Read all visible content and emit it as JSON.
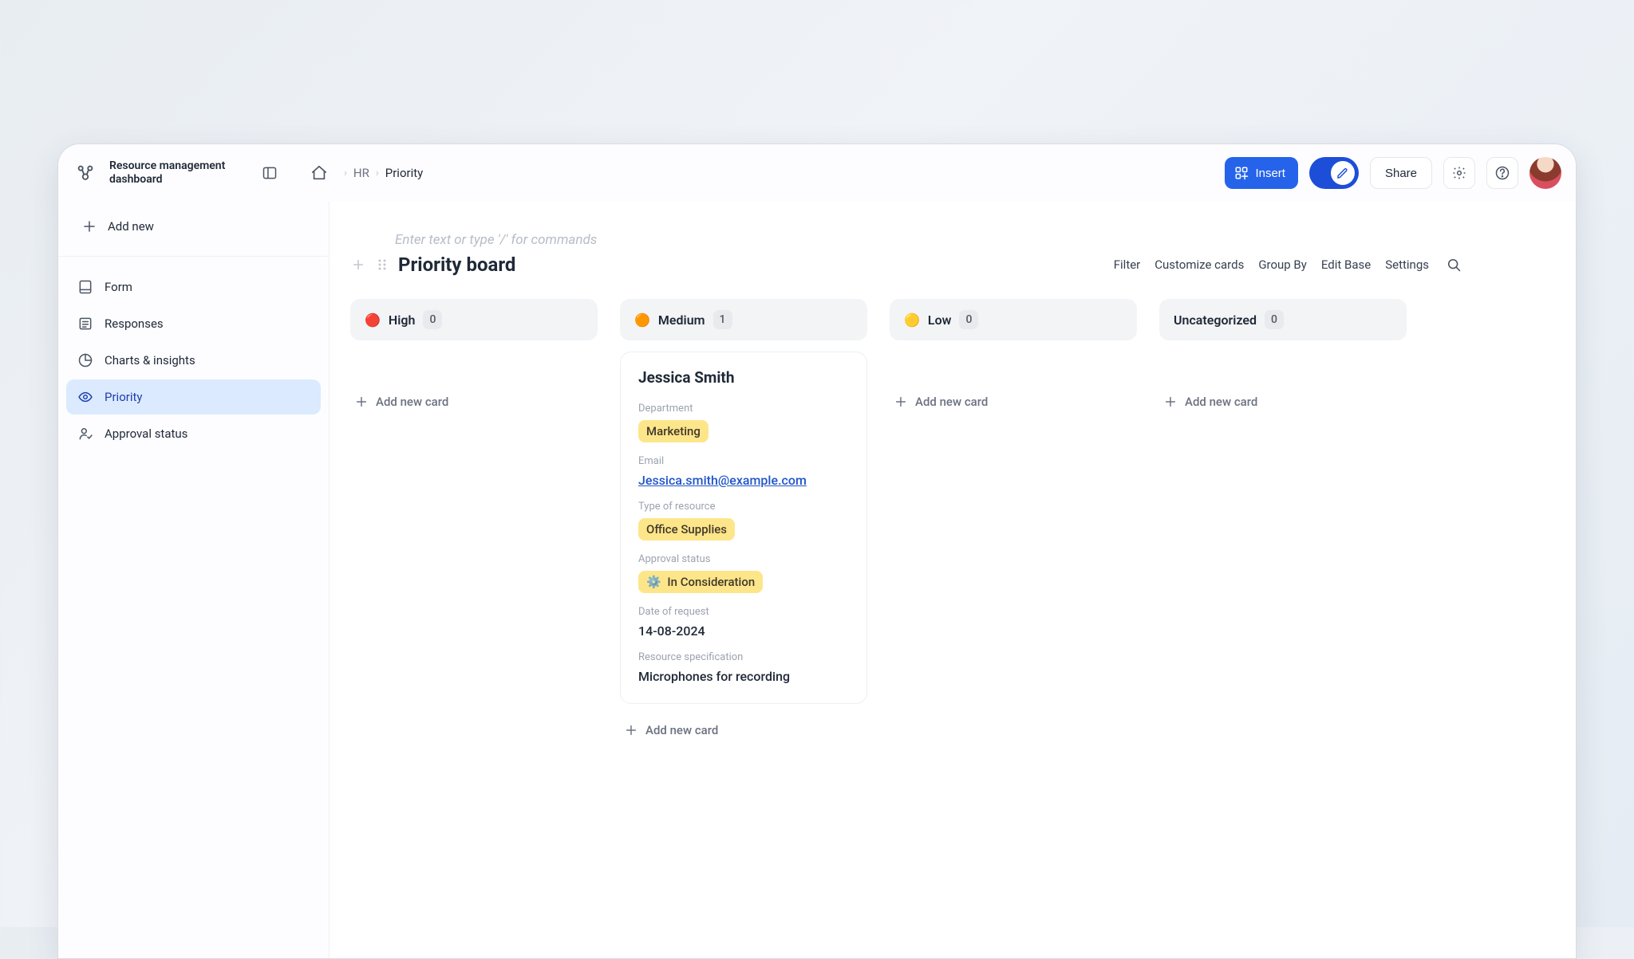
{
  "workspace_title": "Resource management dashboard",
  "breadcrumbs": {
    "section": "HR",
    "page": "Priority"
  },
  "topbar": {
    "insert_label": "Insert",
    "share_label": "Share"
  },
  "sidebar": {
    "add_new_label": "Add new",
    "items": [
      {
        "label": "Form"
      },
      {
        "label": "Responses"
      },
      {
        "label": "Charts & insights"
      },
      {
        "label": "Priority"
      },
      {
        "label": "Approval status"
      }
    ],
    "active_index": 3
  },
  "doc_placeholder": "Enter text or type '/' for commands",
  "board_title": "Priority board",
  "board_actions": {
    "filter": "Filter",
    "customize": "Customize cards",
    "group_by": "Group By",
    "edit_base": "Edit Base",
    "settings": "Settings"
  },
  "columns": [
    {
      "emoji": "🔴",
      "name": "High",
      "count": "0",
      "add_label": "Add new card"
    },
    {
      "emoji": "🟠",
      "name": "Medium",
      "count": "1",
      "add_label": "Add new card"
    },
    {
      "emoji": "🟡",
      "name": "Low",
      "count": "0",
      "add_label": "Add new card"
    },
    {
      "emoji": "",
      "name": "Uncategorized",
      "count": "0",
      "add_label": "Add new card"
    }
  ],
  "card": {
    "title": "Jessica Smith",
    "department_label": "Department",
    "department": "Marketing",
    "email_label": "Email",
    "email": "Jessica.smith@example.com",
    "resource_type_label": "Type of resource",
    "resource_type": "Office Supplies",
    "approval_label": "Approval status",
    "approval_emoji": "⚙️",
    "approval_text": "In Consideration",
    "date_label": "Date of request",
    "date": "14-08-2024",
    "spec_label": "Resource specification",
    "spec": "Microphones for recording"
  }
}
